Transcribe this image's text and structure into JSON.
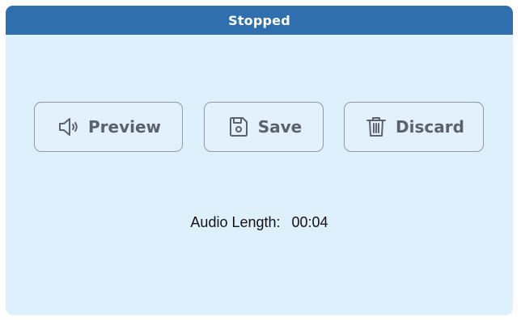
{
  "header": {
    "title": "Stopped"
  },
  "buttons": {
    "preview": {
      "label": "Preview",
      "icon": "speaker-icon"
    },
    "save": {
      "label": "Save",
      "icon": "save-disk-icon"
    },
    "discard": {
      "label": "Discard",
      "icon": "trash-icon"
    }
  },
  "audio": {
    "length_label": "Audio Length:",
    "length_value": "00:04"
  },
  "colors": {
    "header_bg": "#2f6fae",
    "panel_bg": "#dff0fd",
    "button_text": "#5a636b"
  }
}
